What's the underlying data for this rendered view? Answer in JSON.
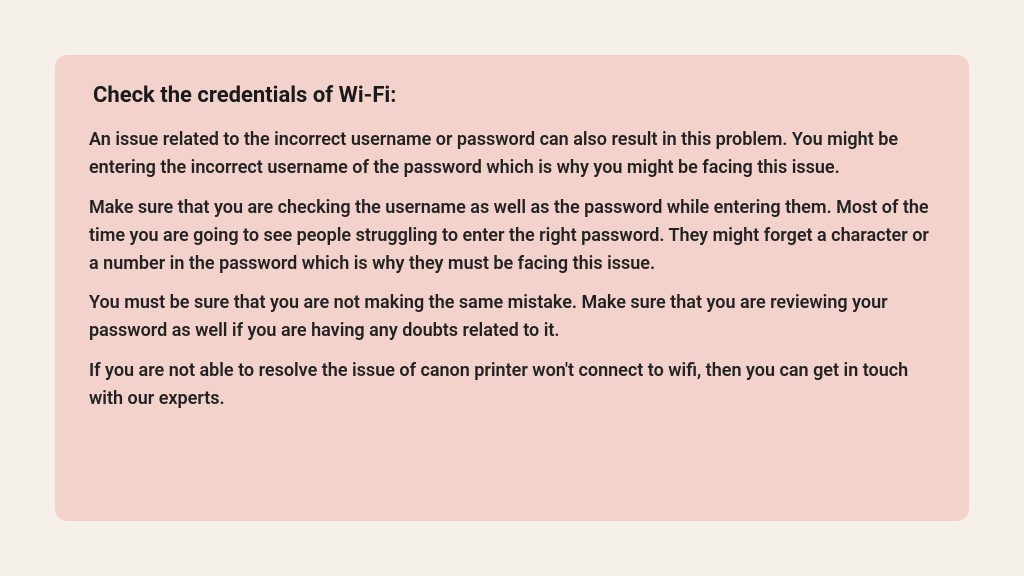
{
  "card": {
    "heading": "Check the credentials of Wi-Fi:",
    "paragraphs": [
      "An issue related to the incorrect username or password can also result in this problem. You might be entering the incorrect username of the password which is why you might be facing this issue.",
      "Make sure that you are checking the username as well as the password while entering them. Most of the time you are going to see people struggling to enter the right password. They might forget a character or a number in the password which is why they must be facing this issue.",
      "You must be sure that you are not making the same mistake. Make sure that you are reviewing your password as well if you are having any doubts related to it.",
      "If you are not able to resolve the issue of canon printer  won't connect to wifi, then you can get in touch with our experts."
    ]
  }
}
